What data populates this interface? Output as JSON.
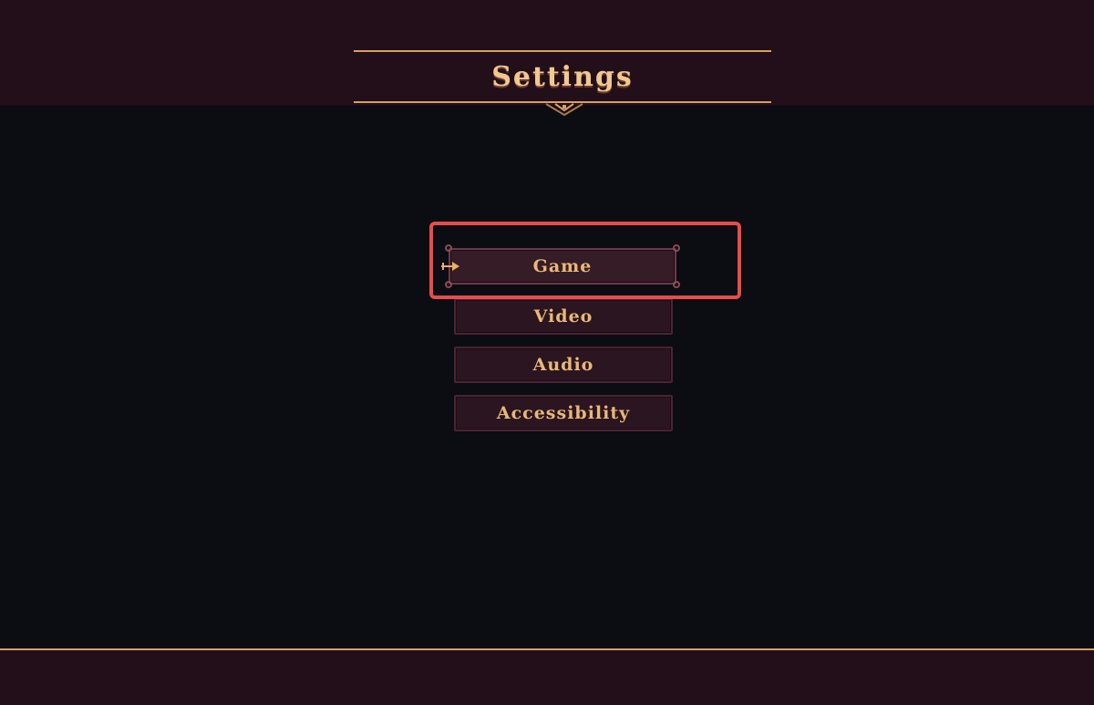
{
  "header": {
    "title": "Settings"
  },
  "menu": {
    "items": [
      {
        "label": "Game",
        "selected": true
      },
      {
        "label": "Video",
        "selected": false
      },
      {
        "label": "Audio",
        "selected": false
      },
      {
        "label": "Accessibility",
        "selected": false
      }
    ]
  },
  "colors": {
    "background": "#0c0c13",
    "bar": "#230f19",
    "gold": "#d8a060",
    "text": "#e8b878",
    "highlight": "#e84c4c"
  },
  "icons": {
    "cursor": "arrow-cursor-icon",
    "ornament": "title-ornament-icon"
  }
}
